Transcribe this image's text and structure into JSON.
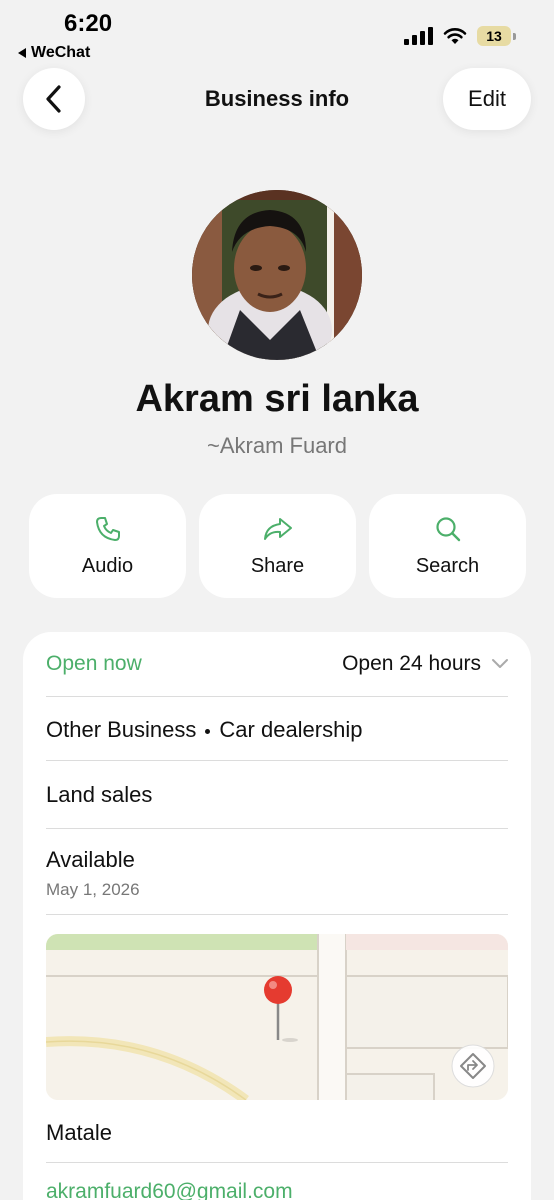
{
  "status_bar": {
    "time": "6:20",
    "back_app": "WeChat",
    "battery": "13",
    "signal_icon": "cellular-signal-icon",
    "wifi_icon": "wifi-icon"
  },
  "nav": {
    "back_icon": "chevron-left-icon",
    "title": "Business info",
    "edit_label": "Edit"
  },
  "profile": {
    "name": "Akram sri lanka",
    "nickname": "~Akram Fuard"
  },
  "actions": [
    {
      "label": "Audio",
      "icon": "phone-icon"
    },
    {
      "label": "Share",
      "icon": "share-arrow-icon"
    },
    {
      "label": "Search",
      "icon": "search-icon"
    }
  ],
  "info": {
    "open_status": "Open now",
    "hours": "Open 24 hours",
    "category_1": "Other Business",
    "category_2": "Car dealership",
    "description": "Land sales",
    "availability_label": "Available",
    "availability_date": "May 1, 2026",
    "location": "Matale",
    "email": "akramfuard60@gmail.com"
  },
  "colors": {
    "accent_green": "#4caf6a",
    "background": "#f2f2f2",
    "card": "#ffffff"
  }
}
